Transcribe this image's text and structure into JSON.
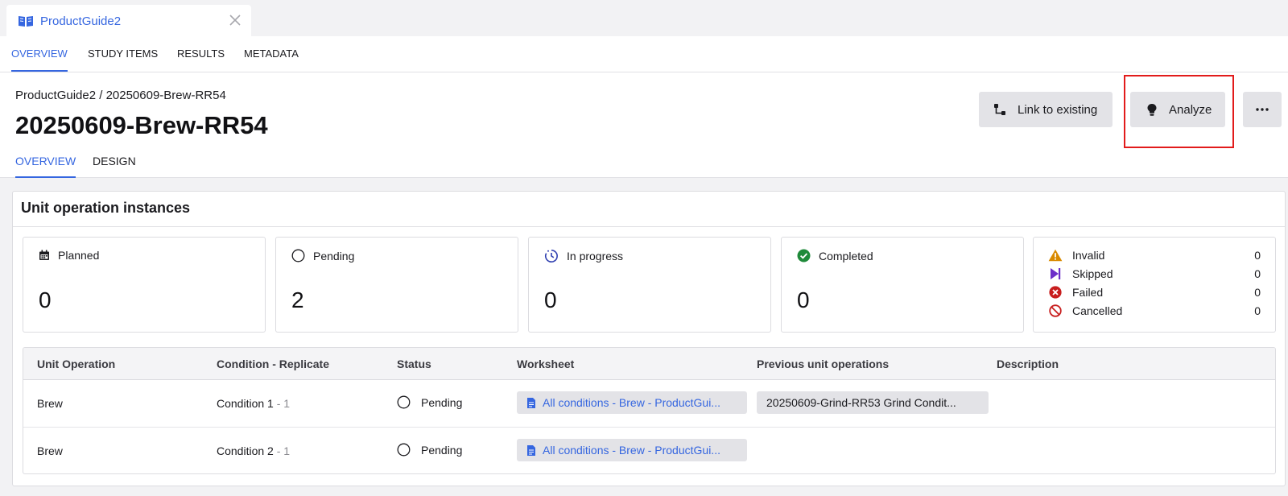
{
  "doc_tab": {
    "title": "ProductGuide2"
  },
  "main_tabs": [
    {
      "label": "OVERVIEW",
      "active": true
    },
    {
      "label": "STUDY ITEMS",
      "active": false
    },
    {
      "label": "RESULTS",
      "active": false
    },
    {
      "label": "METADATA",
      "active": false
    }
  ],
  "header": {
    "breadcrumb": "ProductGuide2 / 20250609-Brew-RR54",
    "title": "20250609-Brew-RR54",
    "sub_tabs": [
      {
        "label": "OVERVIEW",
        "active": true
      },
      {
        "label": "DESIGN",
        "active": false
      }
    ],
    "buttons": {
      "link_existing": "Link to existing",
      "analyze": "Analyze"
    }
  },
  "card": {
    "title": "Unit operation instances",
    "stats": {
      "planned": {
        "label": "Planned",
        "value": "0"
      },
      "pending": {
        "label": "Pending",
        "value": "2"
      },
      "in_progress": {
        "label": "In progress",
        "value": "0"
      },
      "completed": {
        "label": "Completed",
        "value": "0"
      }
    },
    "other_statuses": {
      "invalid": {
        "label": "Invalid",
        "value": "0"
      },
      "skipped": {
        "label": "Skipped",
        "value": "0"
      },
      "failed": {
        "label": "Failed",
        "value": "0"
      },
      "cancelled": {
        "label": "Cancelled",
        "value": "0"
      }
    }
  },
  "table": {
    "columns": {
      "unit_operation": "Unit Operation",
      "condition": "Condition - Replicate",
      "status": "Status",
      "worksheet": "Worksheet",
      "previous": "Previous unit operations",
      "description": "Description"
    },
    "rows": [
      {
        "unit_operation": "Brew",
        "condition": "Condition 1",
        "replicate": " - 1",
        "status": "Pending",
        "worksheet": "All conditions - Brew - ProductGui...",
        "previous": "20250609-Grind-RR53 Grind Condit...",
        "description": ""
      },
      {
        "unit_operation": "Brew",
        "condition": "Condition 2",
        "replicate": " - 1",
        "status": "Pending",
        "worksheet": "All conditions - Brew - ProductGui...",
        "previous": "",
        "description": ""
      }
    ]
  },
  "colors": {
    "accent": "#3566e0",
    "highlight": "#e21b1b",
    "completed": "#1f8a3a",
    "invalid": "#d98a00",
    "skipped": "#6c2fc9",
    "failed": "#c81e1e"
  },
  "icons": {
    "doc_tab": "book-icon",
    "close": "close-icon",
    "link_existing": "link-route-icon",
    "analyze": "lightbulb-icon",
    "more": "more-horizontal-icon",
    "planned": "calendar-icon",
    "pending": "empty-circle-icon",
    "in_progress": "progress-circle-icon",
    "completed": "check-circle-icon",
    "invalid": "warning-triangle-icon",
    "skipped": "skip-icon",
    "failed": "x-circle-icon",
    "cancelled": "no-entry-icon",
    "worksheet": "document-icon"
  }
}
